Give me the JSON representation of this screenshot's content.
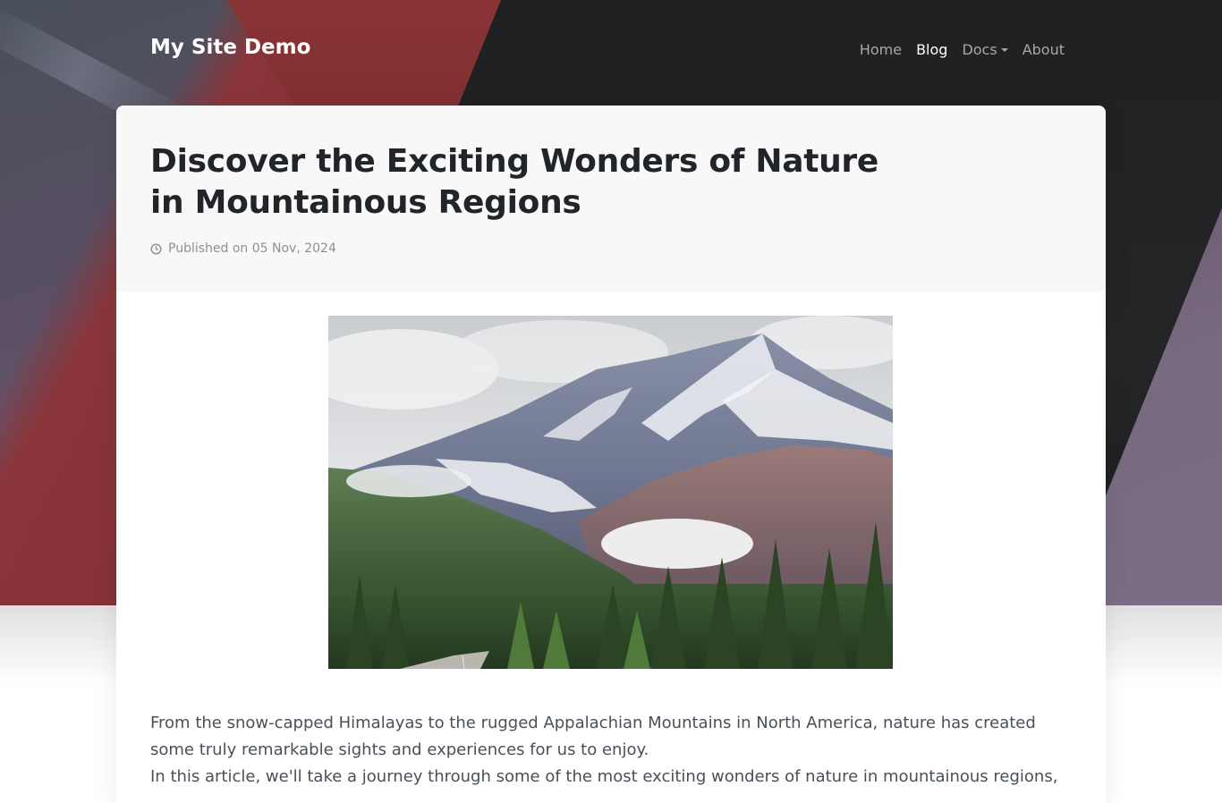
{
  "nav": {
    "brand": "My Site Demo",
    "links": [
      {
        "label": "Home",
        "active": false
      },
      {
        "label": "Blog",
        "active": true
      },
      {
        "label": "Docs",
        "active": false,
        "dropdown": true
      },
      {
        "label": "About",
        "active": false
      }
    ]
  },
  "post": {
    "title": "Discover the Exciting Wonders of Nature in Mountainous Regions",
    "published": "Published on 05 Nov, 2024",
    "meta_icon": "clock-icon",
    "body": [
      "From the snow-capped Himalayas to the rugged Appalachian Mountains in North America, nature has created some truly remarkable sights and experiences for us to enjoy.",
      "In this article, we'll take a journey through some of the most exciting wonders of nature in mountainous regions,"
    ]
  },
  "colors": {
    "accent_red": "#8b3436",
    "dark": "#212529",
    "muted": "#8c9196"
  }
}
